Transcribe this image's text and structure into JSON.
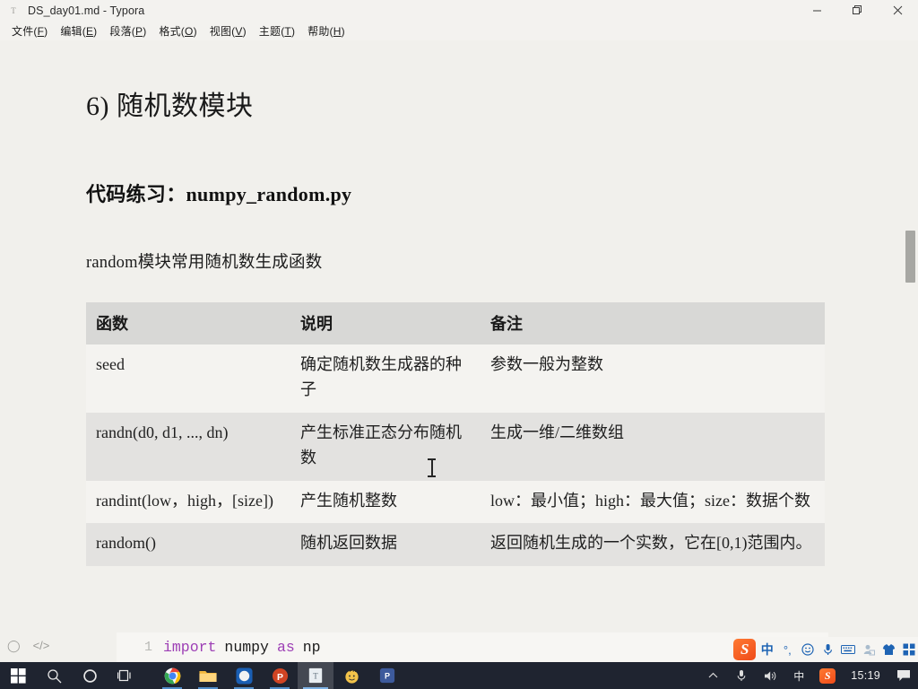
{
  "window": {
    "title": "DS_day01.md - Typora",
    "app_icon": "typora-document-icon",
    "controls": {
      "minimize": "minimize-button",
      "maximize": "restore-button",
      "close": "close-button"
    }
  },
  "menubar": {
    "items": [
      {
        "label": "文件(F)",
        "text": "文件(",
        "key": "F",
        "tail": ")"
      },
      {
        "label": "编辑(E)",
        "text": "编辑(",
        "key": "E",
        "tail": ")"
      },
      {
        "label": "段落(P)",
        "text": "段落(",
        "key": "P",
        "tail": ")"
      },
      {
        "label": "格式(O)",
        "text": "格式(",
        "key": "O",
        "tail": ")"
      },
      {
        "label": "视图(V)",
        "text": "视图(",
        "key": "V",
        "tail": ")"
      },
      {
        "label": "主题(T)",
        "text": "主题(",
        "key": "T",
        "tail": ")"
      },
      {
        "label": "帮助(H)",
        "text": "帮助(",
        "key": "H",
        "tail": ")"
      }
    ]
  },
  "document": {
    "heading": "6) 随机数模块",
    "subheading": "代码练习：numpy_random.py",
    "paragraph": "random模块常用随机数生成函数",
    "table": {
      "headers": [
        "函数",
        "说明",
        "备注"
      ],
      "rows": [
        {
          "function": "seed",
          "description": "确定随机数生成器的种子",
          "note": "参数一般为整数"
        },
        {
          "function": "randn(d0, d1, ..., dn)",
          "description": "产生标准正态分布随机数",
          "note": "生成一维/二维数组"
        },
        {
          "function": "randint(low，high，[size])",
          "description": "产生随机整数",
          "note": "low：最小值；high：最大值；size：数据个数"
        },
        {
          "function": "random()",
          "description": "随机返回数据",
          "note": "返回随机生成的一个实数，它在[0,1)范围内。"
        }
      ]
    },
    "code_block": {
      "line_number": "1",
      "tokens": [
        "import",
        "numpy",
        "as",
        "np"
      ],
      "keyword_color": "#9d3fb5"
    }
  },
  "statusbar": {
    "outline_icon": "circle-outline-icon",
    "source_icon": "source-code-icon"
  },
  "ime": {
    "name": "sogou-input-method",
    "logo": "S",
    "mode": "中",
    "punctuation": "°,",
    "buttons": [
      "smiley-icon",
      "microphone-icon",
      "keyboard-icon",
      "user-icon",
      "skin-icon",
      "menu-grid-icon"
    ]
  },
  "taskbar": {
    "start": "windows-start-icon",
    "search": "search-icon",
    "cortana": "cortana-icon",
    "taskview": "task-view-icon",
    "apps": [
      {
        "name": "chrome",
        "running": true
      },
      {
        "name": "file-explorer",
        "running": true
      },
      {
        "name": "edge",
        "running": true
      },
      {
        "name": "powerpoint",
        "running": true
      },
      {
        "name": "typora",
        "running": true,
        "active": true
      },
      {
        "name": "ftp-client",
        "running": false
      },
      {
        "name": "pycharm",
        "running": false
      }
    ],
    "tray": {
      "overflow": "chevron-up-icon",
      "microphone": "microphone-icon",
      "volume": "volume-icon",
      "ime_mode": "中",
      "sogou": "S",
      "clock": "15:19",
      "action_center": "notifications-icon"
    }
  },
  "colors": {
    "page_bg": "#f1f0ec",
    "chrome_bg": "#f3f2ef",
    "table_header_bg": "#d8d8d6",
    "table_row_alt_bg": "#e3e2e0",
    "taskbar_bg": "#1f2430",
    "accent": "#ef4a18"
  }
}
